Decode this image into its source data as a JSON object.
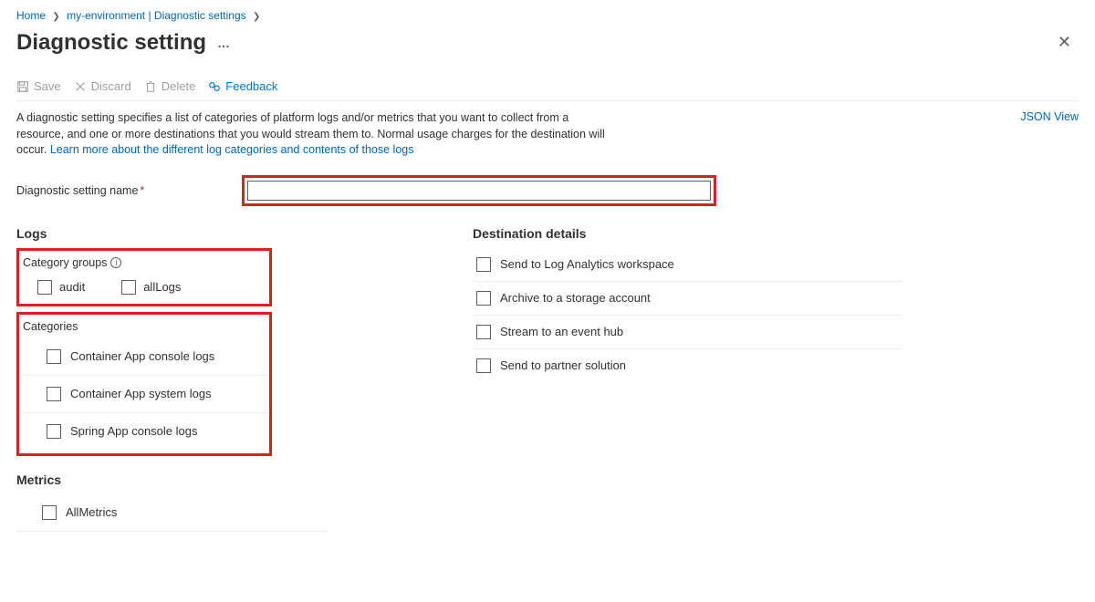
{
  "breadcrumb": {
    "home": "Home",
    "env": "my-environment | Diagnostic settings"
  },
  "page": {
    "title": "Diagnostic setting"
  },
  "toolbar": {
    "save": "Save",
    "discard": "Discard",
    "delete": "Delete",
    "feedback": "Feedback"
  },
  "description": {
    "text": "A diagnostic setting specifies a list of categories of platform logs and/or metrics that you want to collect from a resource, and one or more destinations that you would stream them to. Normal usage charges for the destination will occur. ",
    "link": "Learn more about the different log categories and contents of those logs"
  },
  "jsonView": "JSON View",
  "nameField": {
    "label": "Diagnostic setting name",
    "value": ""
  },
  "logs": {
    "title": "Logs",
    "groupsLabel": "Category groups",
    "groups": [
      {
        "label": "audit"
      },
      {
        "label": "allLogs"
      }
    ],
    "categoriesLabel": "Categories",
    "categories": [
      {
        "label": "Container App console logs"
      },
      {
        "label": "Container App system logs"
      },
      {
        "label": "Spring App console logs"
      }
    ]
  },
  "metrics": {
    "title": "Metrics",
    "items": [
      {
        "label": "AllMetrics"
      }
    ]
  },
  "destinations": {
    "title": "Destination details",
    "items": [
      {
        "label": "Send to Log Analytics workspace"
      },
      {
        "label": "Archive to a storage account"
      },
      {
        "label": "Stream to an event hub"
      },
      {
        "label": "Send to partner solution"
      }
    ]
  }
}
